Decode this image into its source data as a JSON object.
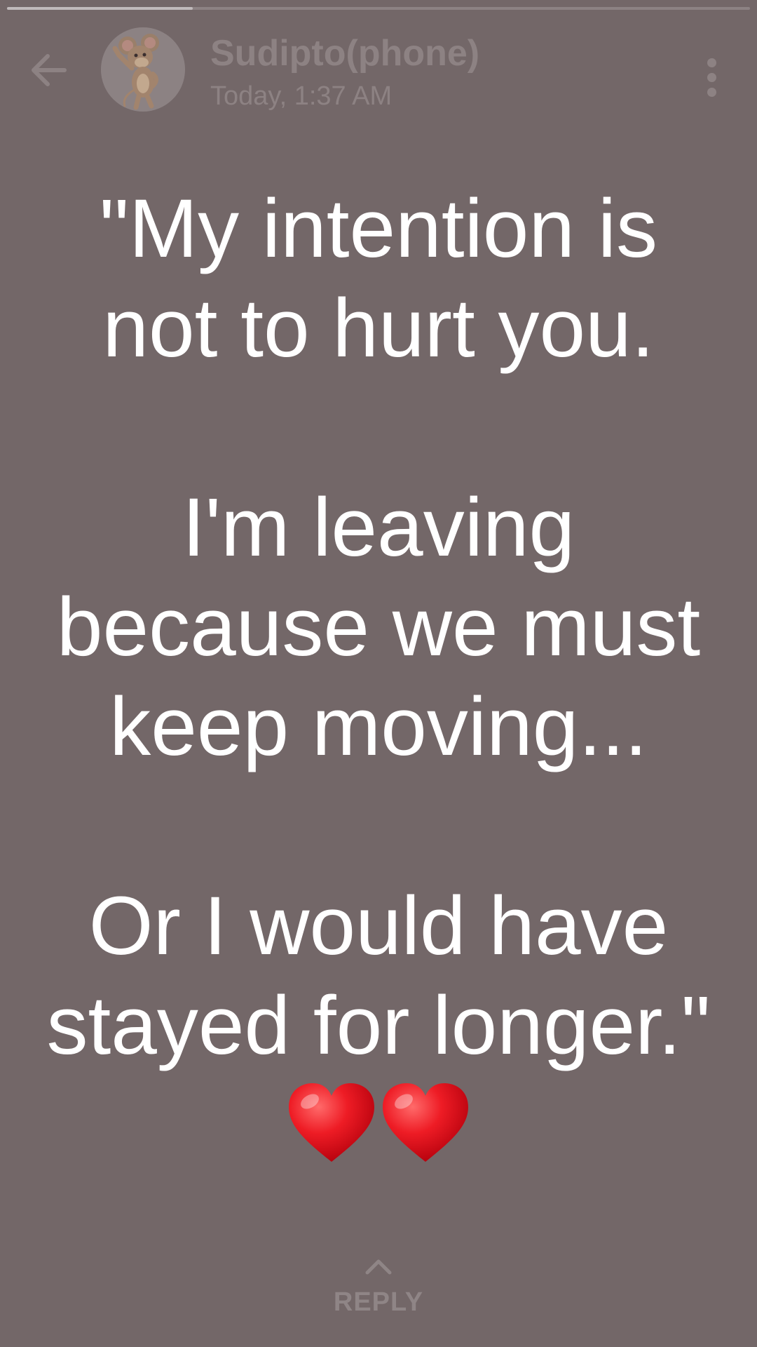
{
  "progress": {
    "fraction": 0.25
  },
  "header": {
    "back_icon": "arrow-left-icon",
    "avatar_icon": "cartoon-mouse-avatar",
    "contact_name": "Sudipto(phone)",
    "timestamp": "Today, 1:37 AM",
    "menu_icon": "more-vertical-icon"
  },
  "status": {
    "lines": [
      "\"My intention is",
      "not to hurt you.",
      "",
      "I'm leaving",
      "because we must",
      "keep moving...",
      "",
      "Or I would have",
      "stayed for longer.\""
    ],
    "emoji": "❤️❤️"
  },
  "reply": {
    "icon": "chevron-up-icon",
    "label": "REPLY"
  },
  "colors": {
    "background": "#736768",
    "text": "#ffffff",
    "muted": "#8d8283",
    "heart": "#e0141e"
  }
}
